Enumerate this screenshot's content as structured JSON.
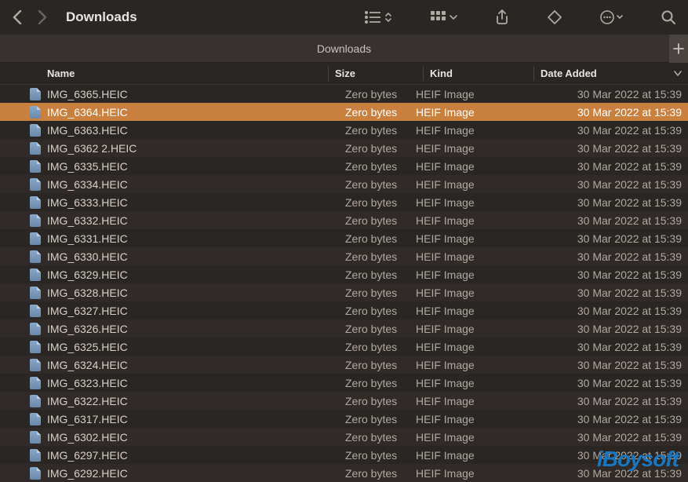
{
  "window": {
    "title": "Downloads",
    "tab_label": "Downloads"
  },
  "columns": {
    "name": "Name",
    "size": "Size",
    "kind": "Kind",
    "date": "Date Added"
  },
  "files": [
    {
      "name": "IMG_6365.HEIC",
      "size": "Zero bytes",
      "kind": "HEIF Image",
      "date": "30 Mar 2022 at 15:39",
      "selected": false
    },
    {
      "name": "IMG_6364.HEIC",
      "size": "Zero bytes",
      "kind": "HEIF Image",
      "date": "30 Mar 2022 at 15:39",
      "selected": true
    },
    {
      "name": "IMG_6363.HEIC",
      "size": "Zero bytes",
      "kind": "HEIF Image",
      "date": "30 Mar 2022 at 15:39",
      "selected": false
    },
    {
      "name": "IMG_6362 2.HEIC",
      "size": "Zero bytes",
      "kind": "HEIF Image",
      "date": "30 Mar 2022 at 15:39",
      "selected": false
    },
    {
      "name": "IMG_6335.HEIC",
      "size": "Zero bytes",
      "kind": "HEIF Image",
      "date": "30 Mar 2022 at 15:39",
      "selected": false
    },
    {
      "name": "IMG_6334.HEIC",
      "size": "Zero bytes",
      "kind": "HEIF Image",
      "date": "30 Mar 2022 at 15:39",
      "selected": false
    },
    {
      "name": "IMG_6333.HEIC",
      "size": "Zero bytes",
      "kind": "HEIF Image",
      "date": "30 Mar 2022 at 15:39",
      "selected": false
    },
    {
      "name": "IMG_6332.HEIC",
      "size": "Zero bytes",
      "kind": "HEIF Image",
      "date": "30 Mar 2022 at 15:39",
      "selected": false
    },
    {
      "name": "IMG_6331.HEIC",
      "size": "Zero bytes",
      "kind": "HEIF Image",
      "date": "30 Mar 2022 at 15:39",
      "selected": false
    },
    {
      "name": "IMG_6330.HEIC",
      "size": "Zero bytes",
      "kind": "HEIF Image",
      "date": "30 Mar 2022 at 15:39",
      "selected": false
    },
    {
      "name": "IMG_6329.HEIC",
      "size": "Zero bytes",
      "kind": "HEIF Image",
      "date": "30 Mar 2022 at 15:39",
      "selected": false
    },
    {
      "name": "IMG_6328.HEIC",
      "size": "Zero bytes",
      "kind": "HEIF Image",
      "date": "30 Mar 2022 at 15:39",
      "selected": false
    },
    {
      "name": "IMG_6327.HEIC",
      "size": "Zero bytes",
      "kind": "HEIF Image",
      "date": "30 Mar 2022 at 15:39",
      "selected": false
    },
    {
      "name": "IMG_6326.HEIC",
      "size": "Zero bytes",
      "kind": "HEIF Image",
      "date": "30 Mar 2022 at 15:39",
      "selected": false
    },
    {
      "name": "IMG_6325.HEIC",
      "size": "Zero bytes",
      "kind": "HEIF Image",
      "date": "30 Mar 2022 at 15:39",
      "selected": false
    },
    {
      "name": "IMG_6324.HEIC",
      "size": "Zero bytes",
      "kind": "HEIF Image",
      "date": "30 Mar 2022 at 15:39",
      "selected": false
    },
    {
      "name": "IMG_6323.HEIC",
      "size": "Zero bytes",
      "kind": "HEIF Image",
      "date": "30 Mar 2022 at 15:39",
      "selected": false
    },
    {
      "name": "IMG_6322.HEIC",
      "size": "Zero bytes",
      "kind": "HEIF Image",
      "date": "30 Mar 2022 at 15:39",
      "selected": false
    },
    {
      "name": "IMG_6317.HEIC",
      "size": "Zero bytes",
      "kind": "HEIF Image",
      "date": "30 Mar 2022 at 15:39",
      "selected": false
    },
    {
      "name": "IMG_6302.HEIC",
      "size": "Zero bytes",
      "kind": "HEIF Image",
      "date": "30 Mar 2022 at 15:39",
      "selected": false
    },
    {
      "name": "IMG_6297.HEIC",
      "size": "Zero bytes",
      "kind": "HEIF Image",
      "date": "30 Mar 2022 at 15:39",
      "selected": false
    },
    {
      "name": "IMG_6292.HEIC",
      "size": "Zero bytes",
      "kind": "HEIF Image",
      "date": "30 Mar 2022 at 15:39",
      "selected": false
    }
  ],
  "watermark": "iBoysoft"
}
